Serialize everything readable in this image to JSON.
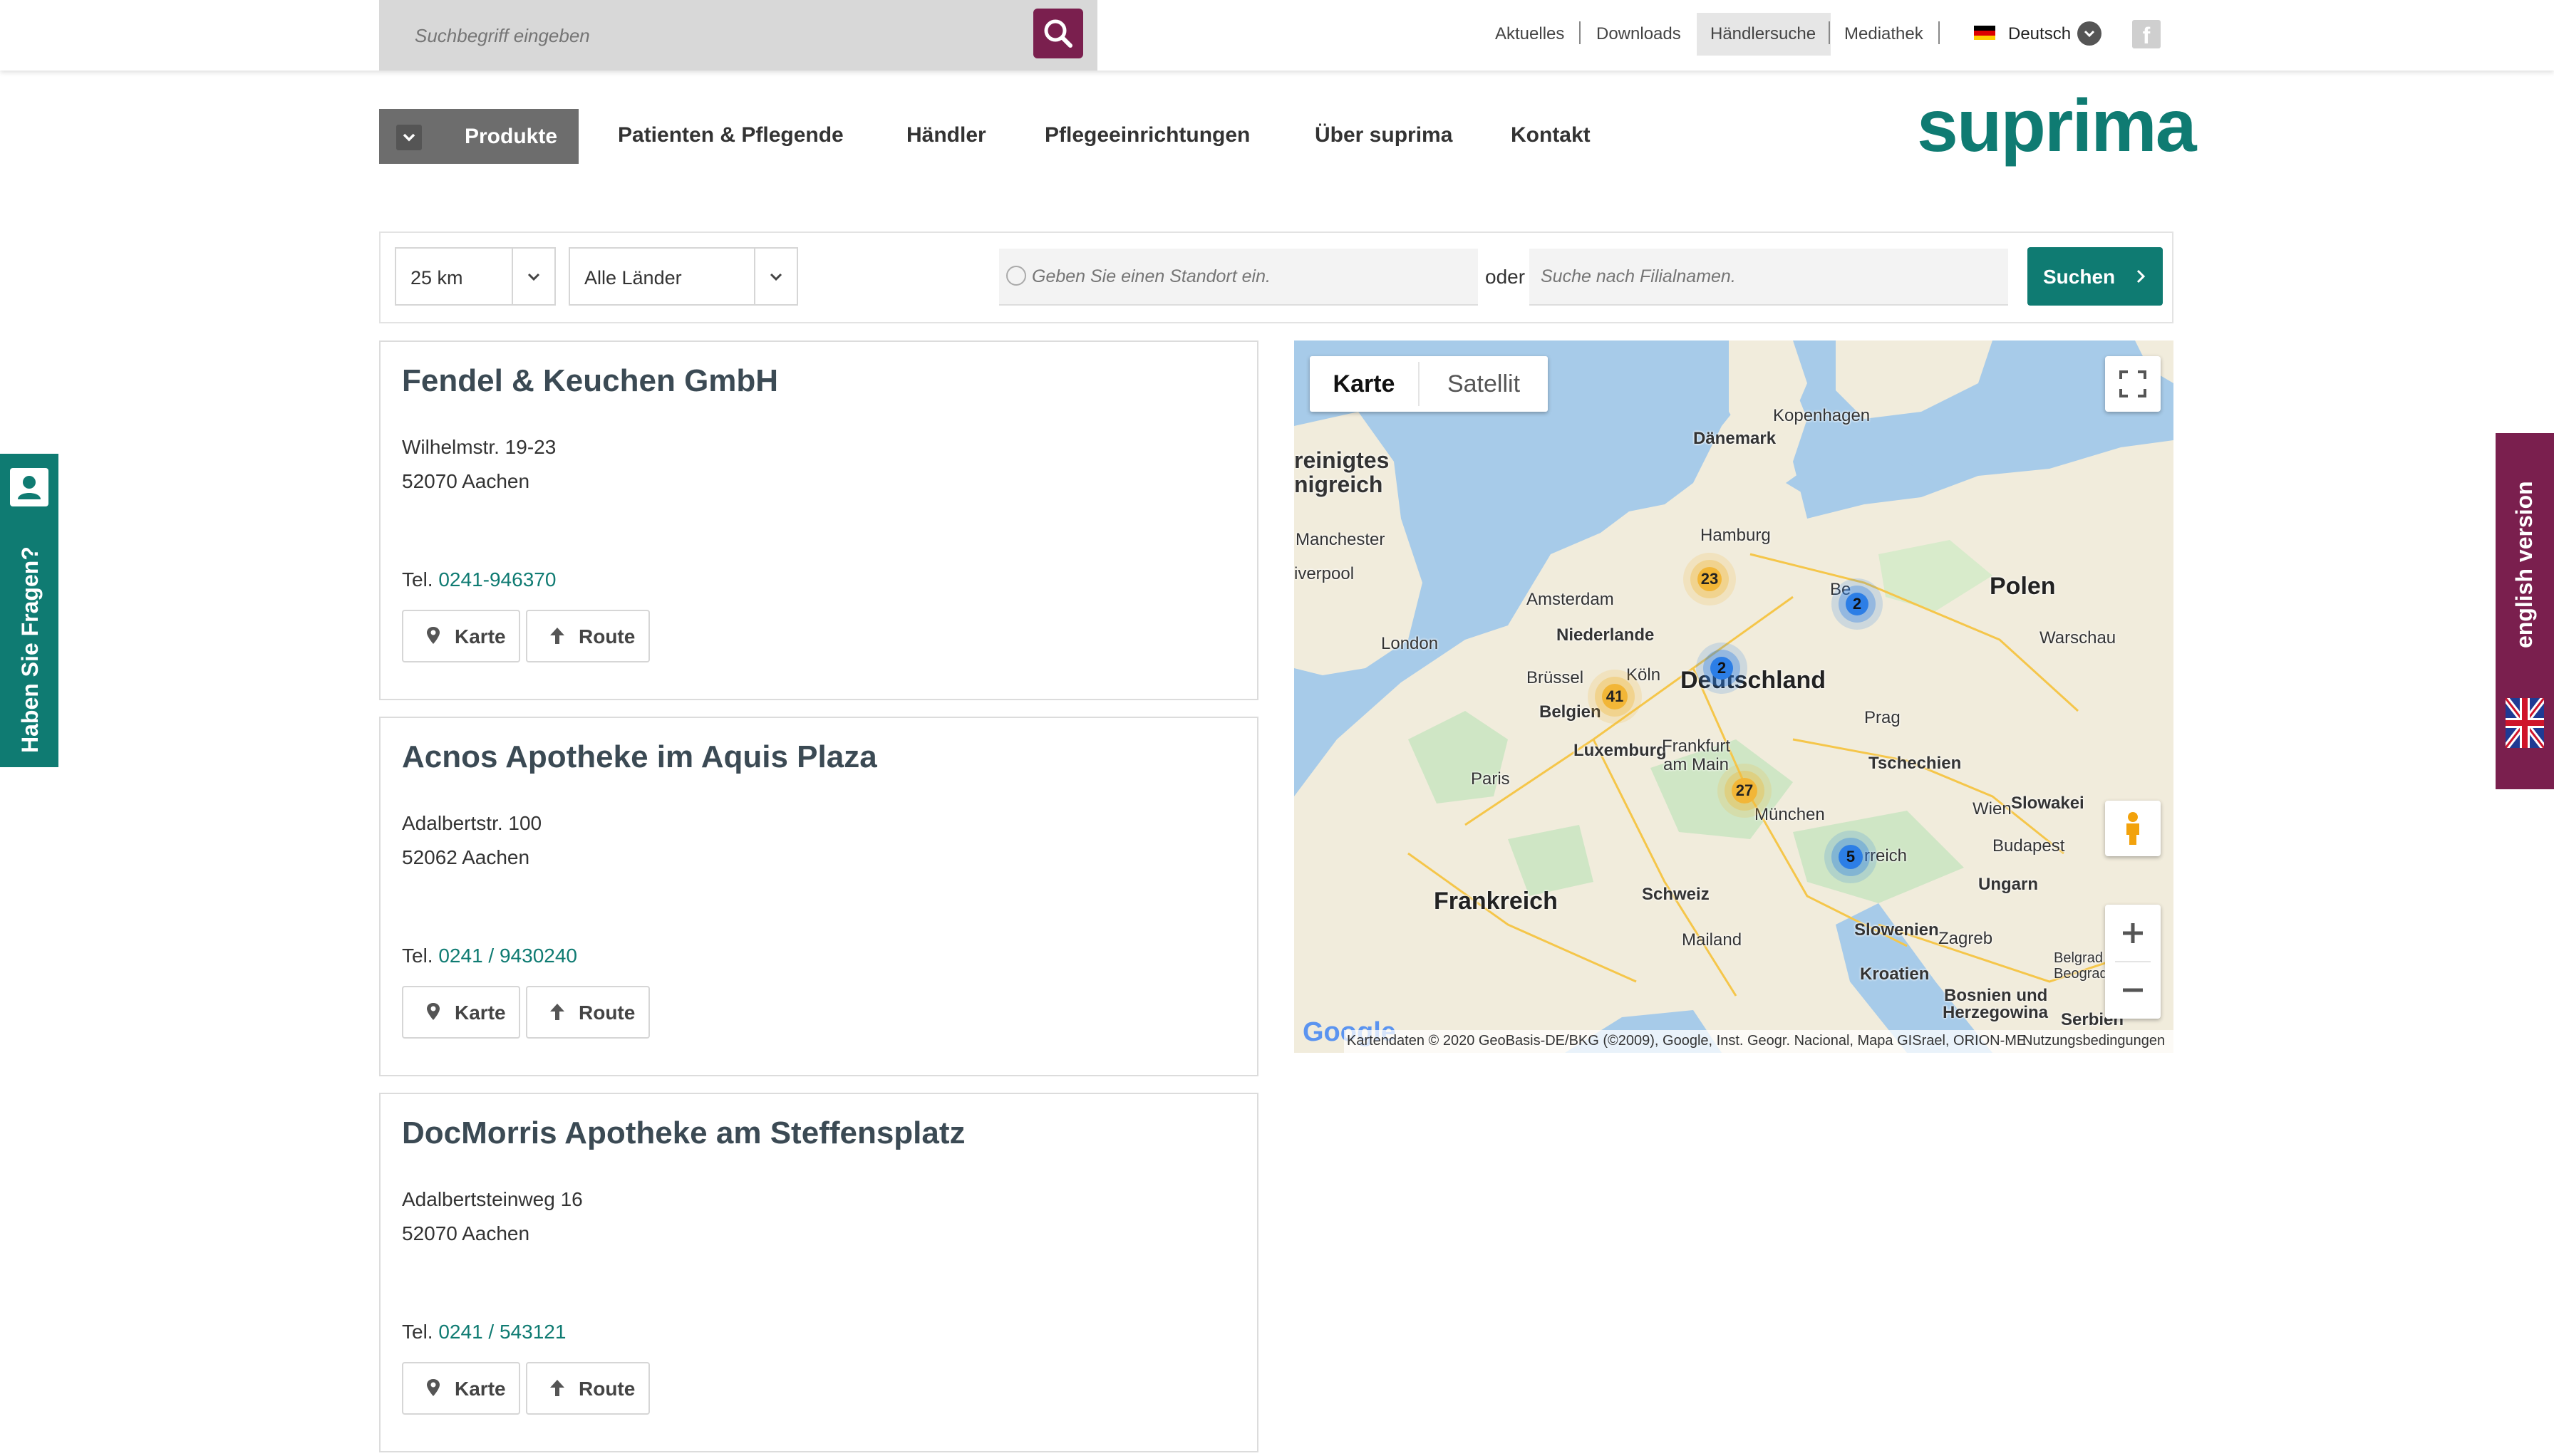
{
  "topbar": {
    "search_placeholder": "Suchbegriff eingeben",
    "links": [
      "Aktuelles",
      "Downloads",
      "Händlersuche",
      "Mediathek"
    ],
    "language": "Deutsch"
  },
  "nav": {
    "items": [
      "Produkte",
      "Patienten & Pflegende",
      "Händler",
      "Pflegeeinrichtungen",
      "Über suprima",
      "Kontakt"
    ],
    "logo": "suprima"
  },
  "filter": {
    "radius": "25 km",
    "country": "Alle Länder",
    "location_placeholder": "Geben Sie einen Standort ein.",
    "or_label": "oder",
    "branch_placeholder": "Suche nach Filialnamen.",
    "search_button": "Suchen"
  },
  "dealers": [
    {
      "name": "Fendel & Keuchen GmbH",
      "street": "Wilhelmstr. 19-23",
      "city": "52070 Aachen",
      "tel_label": "Tel.",
      "tel": "0241-946370",
      "map_button": "Karte",
      "route_button": "Route"
    },
    {
      "name": "Acnos Apotheke im Aquis Plaza",
      "street": "Adalbertstr. 100",
      "city": "52062 Aachen",
      "tel_label": "Tel.",
      "tel": "0241 / 9430240",
      "map_button": "Karte",
      "route_button": "Route"
    },
    {
      "name": "DocMorris Apotheke am Steffensplatz",
      "street": "Adalbertsteinweg 16",
      "city": "52070 Aachen",
      "tel_label": "Tel.",
      "tel": "0241 / 543121",
      "map_button": "Karte",
      "route_button": "Route"
    }
  ],
  "map": {
    "tab_map": "Karte",
    "tab_satellite": "Satellit",
    "labels": {
      "daenemark": "Dänemark",
      "kopenhagen": "Kopenhagen",
      "hamburg": "Hamburg",
      "amsterdam": "Amsterdam",
      "niederlande": "Niederlande",
      "london": "London",
      "bruessel": "Brüssel",
      "belgien": "Belgien",
      "koeln": "Köln",
      "deutschland": "Deutschland",
      "polen": "Polen",
      "warschau": "Warschau",
      "prag": "Prag",
      "tschechien": "Tschechien",
      "luxemburg": "Luxemburg",
      "frankfurt": "Frankfurt",
      "am_main": "am Main",
      "paris": "Paris",
      "muenchen": "München",
      "wien": "Wien",
      "slowakei": "Slowakei",
      "budapest": "Budapest",
      "ungarn": "Ungarn",
      "frankreich": "Frankreich",
      "schweiz": "Schweiz",
      "mailand": "Mailand",
      "slowenien": "Slowenien",
      "zagreb": "Zagreb",
      "kroatien": "Kroatien",
      "bosnien": "Bosnien und",
      "herzegowina": "Herzegowina",
      "serbien": "Serbien",
      "manchester": "Manchester",
      "liverpool": "iverpool",
      "uk1": "reinigtes",
      "uk2": "nigreich",
      "berlin": "Be",
      "oesterreich": "rreich",
      "belgrad": "Belgrad",
      "beograd": "Beograd"
    },
    "clusters": [
      "23",
      "2",
      "2",
      "41",
      "27",
      "5"
    ],
    "attribution": "Kartendaten © 2020 GeoBasis-DE/BKG (©2009), Google, Inst. Geogr. Nacional, Mapa GISrael, ORION-ME",
    "terms": "Nutzungsbedingungen",
    "google": "Google"
  },
  "side": {
    "left": "Haben Sie Fragen?",
    "right": "english version"
  },
  "colors": {
    "teal": "#0f7b72",
    "plum": "#7a1f4e",
    "grey": "#6d6d6d"
  }
}
